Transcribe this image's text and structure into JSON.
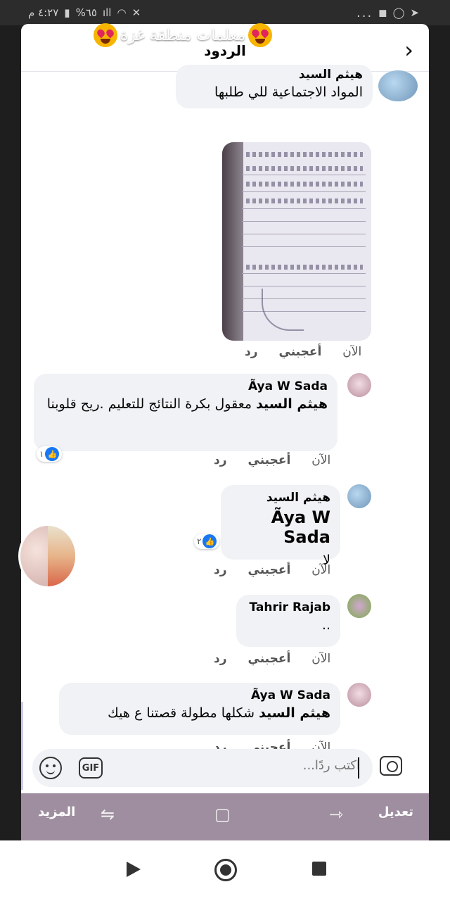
{
  "status_bar": {
    "time": "٤:٢٧ م",
    "battery": "%٦٥",
    "dots": "..."
  },
  "overlay": {
    "group_title": "معلمات منطقة غزة"
  },
  "header": {
    "title": "الردود"
  },
  "comments": [
    {
      "author": "هيثم السيد",
      "text": "المواد الاجتماعية للي طلبها",
      "time": "الآن",
      "like": "أعجبني",
      "reply": "رد"
    },
    {
      "author": "Ãya W Sada",
      "mention": "هيثم السيد",
      "text": "معقول بكرة النتائج للتعليم .ريح قلوبنا",
      "time": "الآن",
      "like": "أعجبني",
      "reply": "رد",
      "reaction_count": "١"
    },
    {
      "author": "هيثم السيد",
      "mention": "Ãya W Sada",
      "text": "لا",
      "time": "الآن",
      "like": "أعجبني",
      "reply": "رد",
      "reaction_count": "٢"
    },
    {
      "author": "Tahrir Rajab",
      "text": "..",
      "time": "الآن",
      "like": "أعجبني",
      "reply": "رد"
    },
    {
      "author": "Ãya W Sada",
      "mention": "هيثم السيد",
      "text": "شكلها مطولة قصتنا ع هيك",
      "time": "الآن",
      "like": "أعجبني",
      "reply": "رد"
    }
  ],
  "composer": {
    "placeholder": "اكتب ردًا..."
  },
  "toolbar": {
    "edit": "تعديل",
    "more": "المزيد"
  },
  "colors": {
    "like_blue": "#1877f2",
    "bubble_bg": "#f0f2f5",
    "toolbar_bg": "#9e8e9f"
  }
}
